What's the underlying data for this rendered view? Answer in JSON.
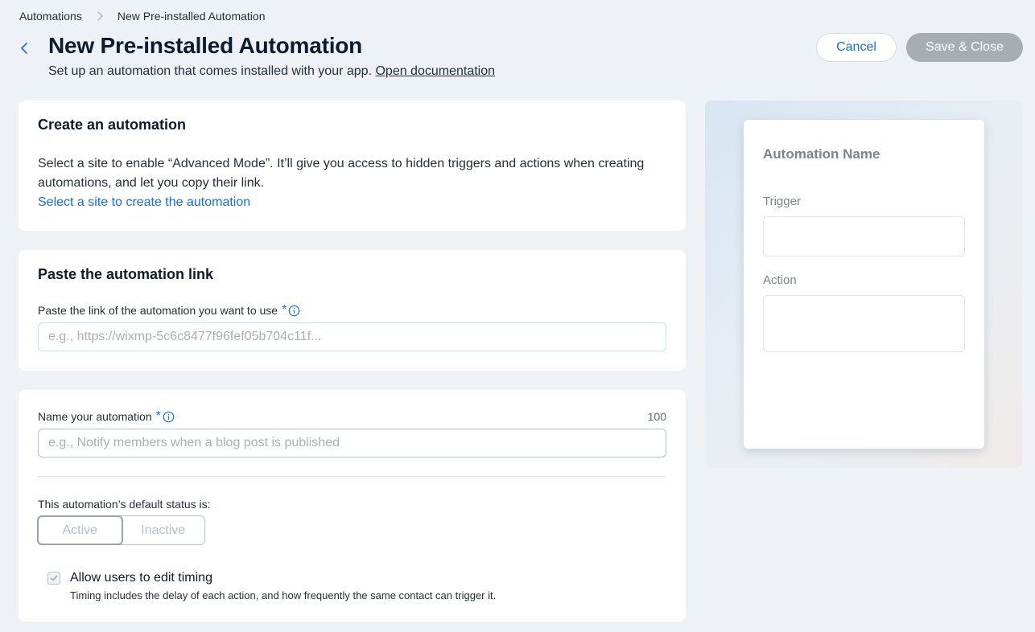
{
  "breadcrumb": {
    "root": "Automations",
    "current": "New Pre-installed Automation"
  },
  "header": {
    "title": "New Pre-installed Automation",
    "subtitle": "Set up an automation that comes installed with your app.",
    "doc_link": "Open documentation",
    "cancel_label": "Cancel",
    "save_label": "Save & Close"
  },
  "create_card": {
    "title": "Create an automation",
    "text": "Select a site to enable “Advanced Mode”. It’ll give you access to hidden triggers and actions when creating automations, and let you copy their link.",
    "link": "Select a site to create the automation"
  },
  "paste_card": {
    "title": "Paste the automation link",
    "field_label": "Paste the link of the automation you want to use",
    "required_mark": "*",
    "placeholder": "e.g., https://wixmp-5c6c8477f96fef05b704c11f...",
    "value": ""
  },
  "details_card": {
    "name_label": "Name your automation",
    "required_mark": "*",
    "char_limit": "100",
    "name_placeholder": "e.g., Notify members when a blog post is published",
    "name_value": "",
    "status_label": "This automation’s default status is:",
    "status_options": [
      "Active",
      "Inactive"
    ],
    "status_selected": "Active",
    "timing_label": "Allow users to edit timing",
    "timing_hint": "Timing includes the delay of each action, and how frequently the same contact can trigger it.",
    "timing_checked": true
  },
  "preview": {
    "name": "Automation Name",
    "trigger_label": "Trigger",
    "action_label": "Action"
  },
  "icons": {
    "back": "chevron-left-icon",
    "breadcrumb_separator": "chevron-right-icon",
    "info": "info-icon",
    "check": "check-icon"
  },
  "colors": {
    "accent": "#116dff",
    "background": "#eef1f5",
    "save_disabled": "#a8acb4"
  }
}
